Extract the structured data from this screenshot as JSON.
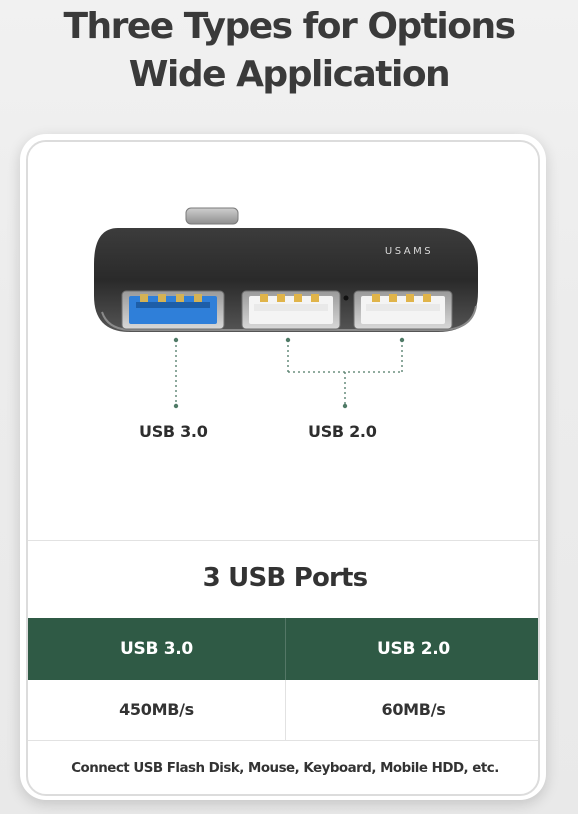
{
  "headline": {
    "line1": "Three Types for Options",
    "line2": "Wide Application"
  },
  "product": {
    "brand": "USAMS",
    "ports": [
      {
        "label": "USB 3.0",
        "color": "#2f7fd9"
      },
      {
        "label": "USB 2.0",
        "color": "#e0b44a"
      }
    ]
  },
  "spec": {
    "title": "3 USB Ports",
    "headers": [
      "USB 3.0",
      "USB 2.0"
    ],
    "values": [
      "450MB/s",
      "60MB/s"
    ],
    "note": "Connect USB Flash Disk, Mouse, Keyboard, Mobile HDD, etc.",
    "header_color": "#2f5a45"
  }
}
